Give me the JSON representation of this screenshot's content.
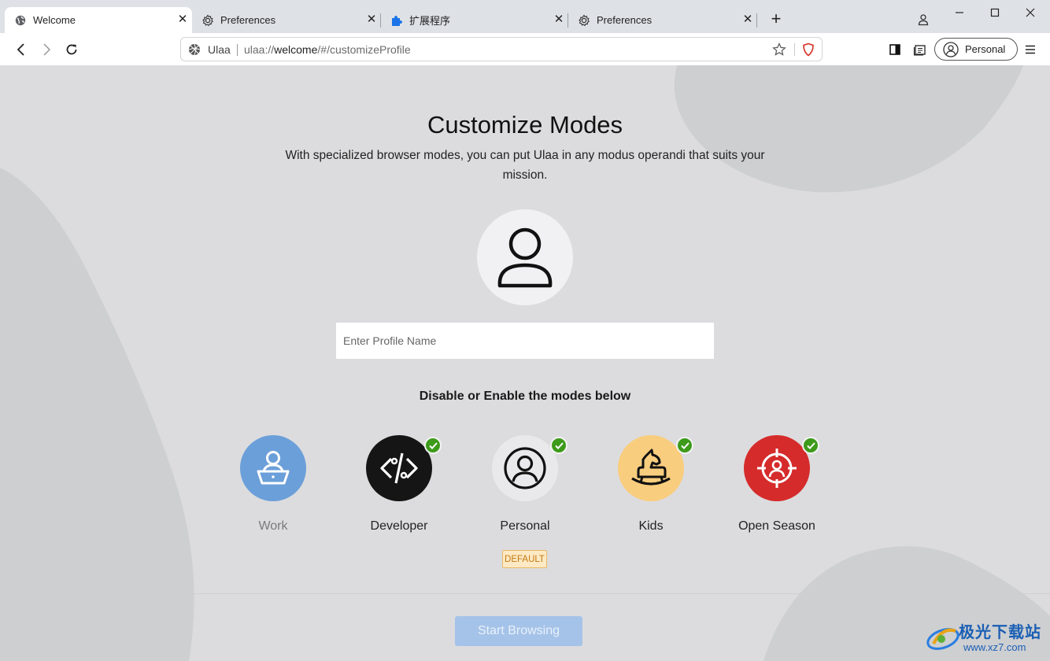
{
  "tabs": [
    {
      "label": "Welcome",
      "icon": "globe-icon",
      "active": true
    },
    {
      "label": "Preferences",
      "icon": "gear-icon",
      "active": false
    },
    {
      "label": "扩展程序",
      "icon": "puzzle-icon",
      "active": false
    },
    {
      "label": "Preferences",
      "icon": "gear-icon",
      "active": false
    }
  ],
  "new_tab_label": "+",
  "omnibox": {
    "site_label": "Ulaa",
    "url_scheme": "ulaa://",
    "url_host": "welcome",
    "url_path": "/#/customizeProfile"
  },
  "profile_button_label": "Personal",
  "page": {
    "title": "Customize Modes",
    "subtitle": "With specialized browser modes, you can put Ulaa in any modus operandi that suits your mission.",
    "profile_name_placeholder": "Enter Profile Name",
    "profile_name_value": "",
    "modes_heading": "Disable or Enable the modes below",
    "modes": [
      {
        "label": "Work",
        "icon": "work-laptop-icon",
        "color": "#6b9fd9",
        "enabled": false
      },
      {
        "label": "Developer",
        "icon": "code-icon",
        "color": "#151515",
        "enabled": true
      },
      {
        "label": "Personal",
        "icon": "person-icon",
        "color": "#e9e9eb",
        "enabled": true
      },
      {
        "label": "Kids",
        "icon": "rocking-horse-icon",
        "color": "#f9cd7e",
        "enabled": true
      },
      {
        "label": "Open Season",
        "icon": "target-person-icon",
        "color": "#d52b2b",
        "enabled": true
      }
    ],
    "default_badge": "DEFAULT",
    "start_button_label": "Start Browsing"
  },
  "watermark": {
    "text": "极光下载站",
    "url": "www.xz7.com"
  },
  "colors": {
    "accent": "#a5c3e8",
    "check": "#3d9a1a",
    "badge": "#fde9c4"
  }
}
